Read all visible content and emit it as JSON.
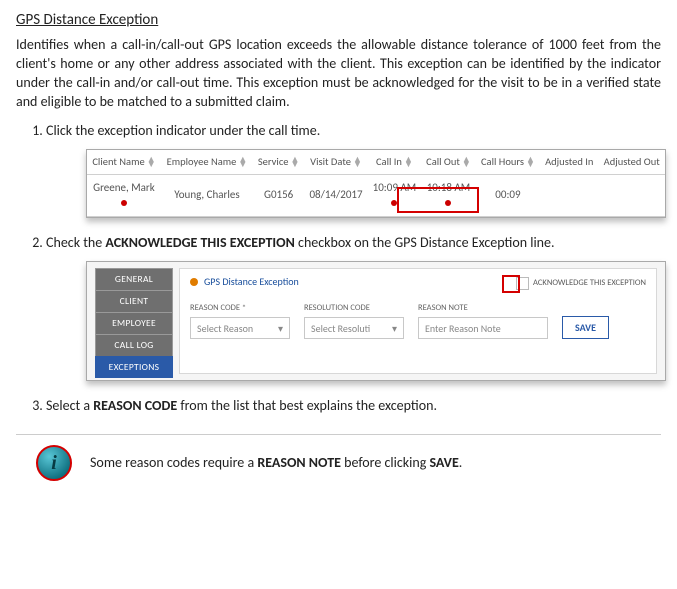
{
  "title": "GPS Distance Exception",
  "intro": "Identifies when a call-in/call-out GPS location exceeds the allowable distance tolerance of 1000 feet from the client's home or any other address associated with the client. This exception can be identified by the indicator under the call-in and/or call-out time. This exception must be acknowledged for the visit to be in a verified state and eligible to be matched to a submitted claim.",
  "steps": {
    "s1": "Click the exception indicator under the call time.",
    "s2_pre": "Check the ",
    "s2_bold": "ACKNOWLEDGE THIS EXCEPTION",
    "s2_post": " checkbox on the GPS Distance Exception line.",
    "s3_pre": "Select a ",
    "s3_bold": "REASON CODE",
    "s3_post": " from the list that best explains the exception."
  },
  "table": {
    "headers": {
      "client": "Client Name",
      "employee": "Employee Name",
      "service": "Service",
      "visit": "Visit Date",
      "callin": "Call In",
      "callout": "Call Out",
      "callhours": "Call Hours",
      "adjin": "Adjusted In",
      "adjout": "Adjusted Out"
    },
    "row": {
      "client": "Greene, Mark",
      "employee": "Young, Charles",
      "service": "G0156",
      "date": "08/14/2017",
      "in": "10:09 AM",
      "out": "10:18 AM",
      "hours": "00:09"
    }
  },
  "panel": {
    "tabs": {
      "general": "GENERAL",
      "client": "CLIENT",
      "employee": "EMPLOYEE",
      "calllog": "CALL LOG",
      "exceptions": "EXCEPTIONS"
    },
    "exception_name": "GPS Distance Exception",
    "ack_label": "ACKNOWLEDGE THIS EXCEPTION",
    "reason_lbl": "REASON CODE *",
    "reason_ph": "Select Reason",
    "resolution_lbl": "RESOLUTION CODE",
    "resolution_ph": "Select Resoluti",
    "note_lbl": "REASON NOTE",
    "note_ph": "Enter Reason Note",
    "save": "SAVE"
  },
  "note": {
    "pre": "Some reason codes require a ",
    "b1": "REASON NOTE",
    "mid": " before clicking ",
    "b2": "SAVE",
    "post": "."
  }
}
